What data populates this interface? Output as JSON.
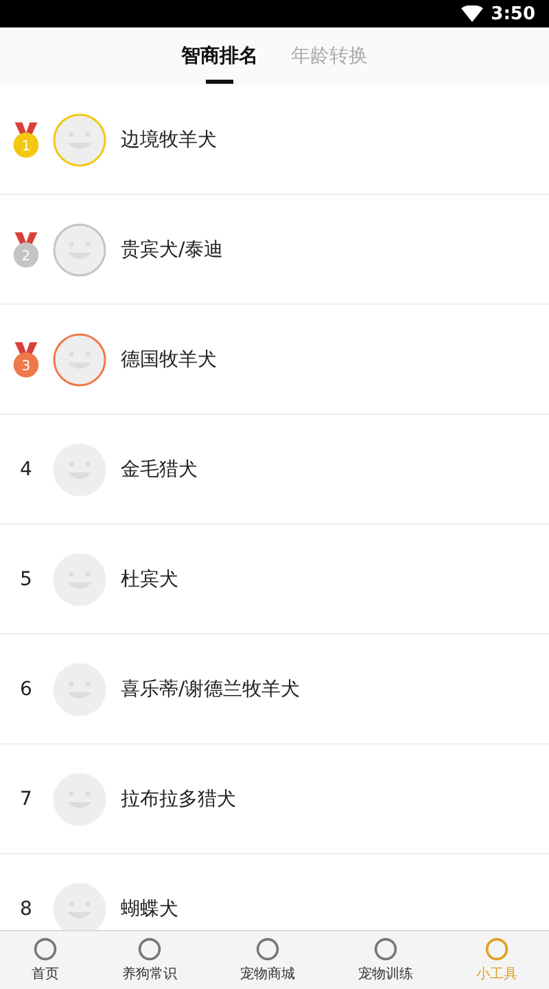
{
  "status_bar": {
    "time": "3:50"
  },
  "tabs": [
    {
      "label": "智商排名",
      "selected": true
    },
    {
      "label": "年龄转换",
      "selected": false
    }
  ],
  "ranking": [
    {
      "kind": "medal",
      "rank": "1",
      "color": "#f2c811",
      "name": "边境牧羊犬"
    },
    {
      "kind": "medal",
      "rank": "2",
      "color": "#c4c4c4",
      "name": "贵宾犬/泰迪"
    },
    {
      "kind": "medal",
      "rank": "3",
      "color": "#ee7a4c",
      "name": "德国牧羊犬"
    },
    {
      "kind": "number",
      "rank": "4",
      "name": "金毛猎犬"
    },
    {
      "kind": "number",
      "rank": "5",
      "name": "杜宾犬"
    },
    {
      "kind": "number",
      "rank": "6",
      "name": "喜乐蒂/谢德兰牧羊犬"
    },
    {
      "kind": "number",
      "rank": "7",
      "name": "拉布拉多猎犬"
    },
    {
      "kind": "number",
      "rank": "8",
      "name": "蝴蝶犬"
    }
  ],
  "bottom_nav": [
    {
      "label": "首页",
      "selected": false
    },
    {
      "label": "养狗常识",
      "selected": false
    },
    {
      "label": "宠物商城",
      "selected": false
    },
    {
      "label": "宠物训练",
      "selected": false
    },
    {
      "label": "小工具",
      "selected": true
    }
  ]
}
